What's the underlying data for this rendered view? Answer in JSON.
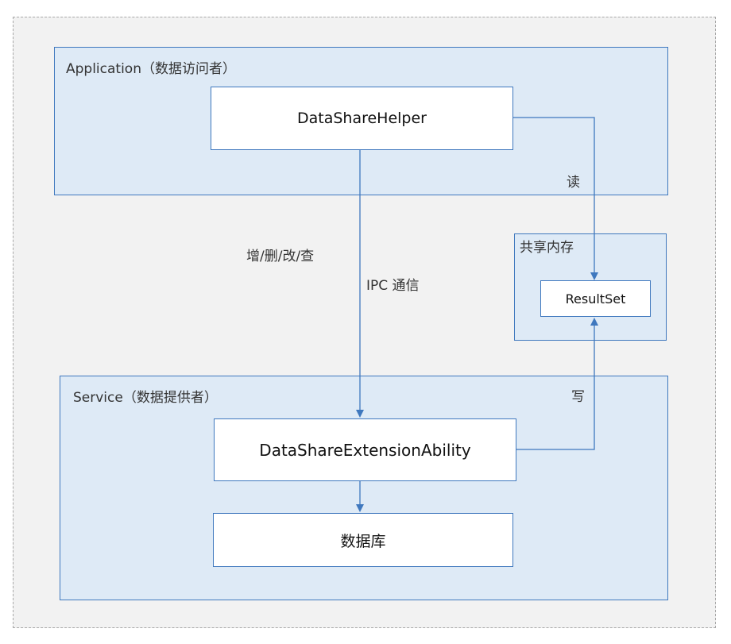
{
  "zones": {
    "application": {
      "label": "Application（数据访问者）"
    },
    "shared_memory": {
      "label": "共享内存"
    },
    "service": {
      "label": "Service（数据提供者）"
    }
  },
  "nodes": {
    "datashare_helper": {
      "label": "DataShareHelper"
    },
    "result_set": {
      "label": "ResultSet"
    },
    "datashare_extension_ability": {
      "label": "DataShareExtensionAbility"
    },
    "database": {
      "label": "数据库"
    }
  },
  "edges": {
    "crud": {
      "label": "增/删/改/查"
    },
    "ipc": {
      "label": "IPC 通信"
    },
    "read": {
      "label": "读"
    },
    "write": {
      "label": "写"
    }
  },
  "colors": {
    "line": "#3f78be",
    "zone_fill": "#deeaf6",
    "canvas_fill": "#f2f2f2"
  }
}
